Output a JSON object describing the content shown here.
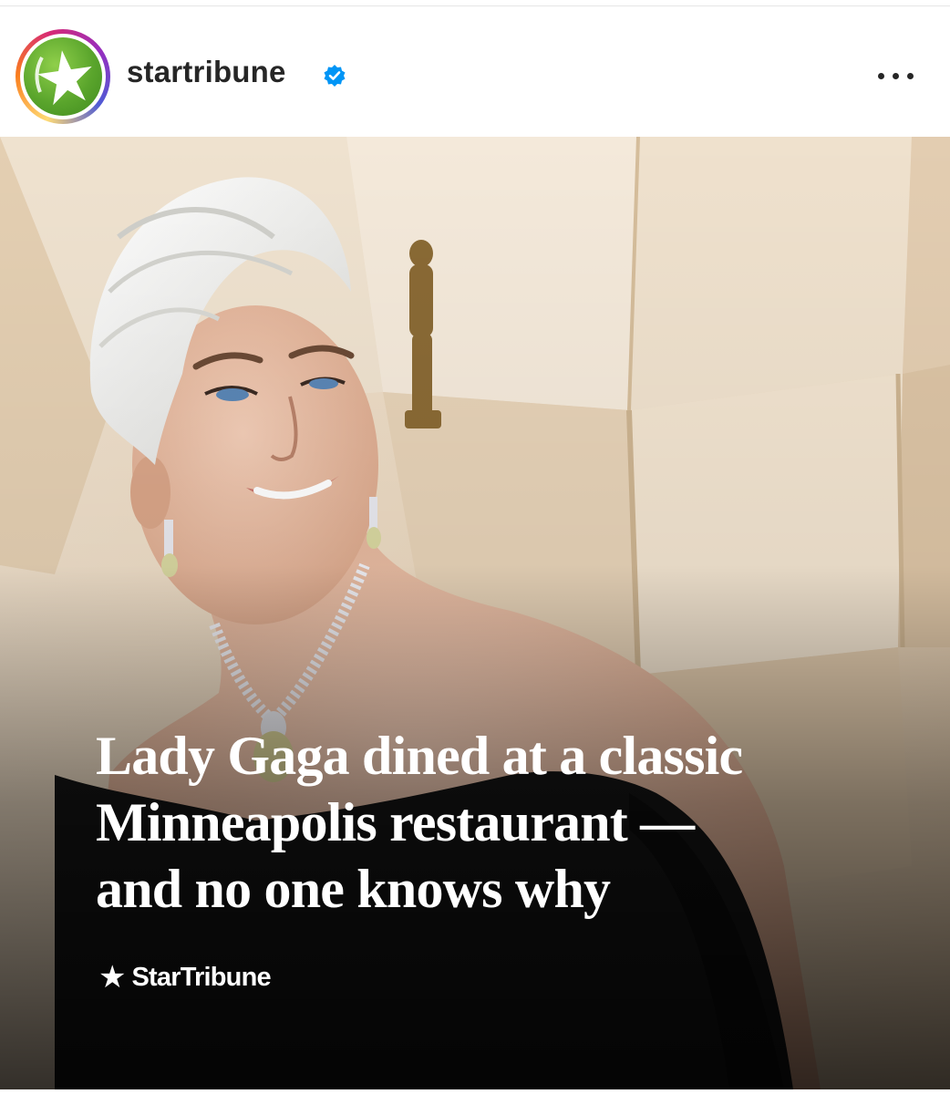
{
  "header": {
    "username": "startribune",
    "verified": true,
    "avatar_icon": "star-logo-icon",
    "more_icon": "more-options-icon",
    "colors": {
      "avatar_green": "#5aa52c",
      "verified_blue": "#0095f6",
      "username": "#262626"
    }
  },
  "post": {
    "image_icon": "lady-gaga-photo",
    "headline_lines": [
      "Lady Gaga dined at a classic",
      "Minneapolis restaurant —",
      "and no one knows why"
    ],
    "brand": {
      "star": "★",
      "name": "StarTribune"
    }
  }
}
